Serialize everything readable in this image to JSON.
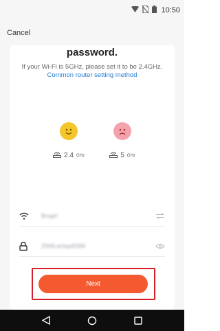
{
  "status_bar": {
    "time": "10:50",
    "icons": [
      "wifi-signal-icon",
      "no-sim-icon",
      "battery-icon"
    ]
  },
  "header": {
    "cancel_label": "Cancel"
  },
  "card": {
    "title": "password.",
    "hint_text": "If your Wi-Fi is 5GHz, please set it to be 2.4GHz.",
    "hint_link": "Common router setting method",
    "bands": [
      {
        "value": "2.4",
        "unit": "GHz",
        "face": "happy-face-icon",
        "color": "#f5c52a"
      },
      {
        "value": "5",
        "unit": "GHz",
        "face": "sad-face-icon",
        "color": "#f4a3ac"
      }
    ],
    "wifi_field": {
      "value": "Bruget",
      "icon": "wifi-icon",
      "trail_icon": "switch-arrows-icon"
    },
    "password_field": {
      "value": "2006LanIspd2066",
      "icon": "lock-icon",
      "trail_icon": "eye-icon"
    },
    "next_label": "Next",
    "accent_color": "#f4592f",
    "highlight_color": "#d61e2a"
  },
  "navbar": {
    "buttons": [
      "back-icon",
      "home-icon",
      "recents-icon"
    ]
  }
}
